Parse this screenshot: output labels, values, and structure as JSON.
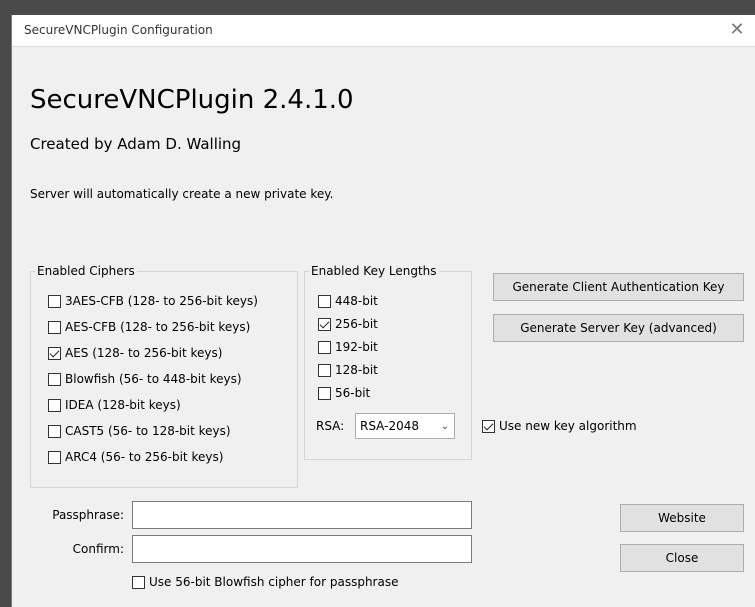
{
  "window": {
    "title": "SecureVNCPlugin Configuration",
    "close_glyph": "✕"
  },
  "header": {
    "title": "SecureVNCPlugin 2.4.1.0",
    "author": "Created by Adam D. Walling",
    "info": "Server will automatically create a new private key."
  },
  "ciphers": {
    "legend": "Enabled Ciphers",
    "items": [
      {
        "label": "3AES-CFB (128- to 256-bit keys)",
        "checked": false
      },
      {
        "label": "AES-CFB (128- to 256-bit keys)",
        "checked": false
      },
      {
        "label": "AES (128- to 256-bit keys)",
        "checked": true
      },
      {
        "label": "Blowfish (56- to 448-bit keys)",
        "checked": false
      },
      {
        "label": "IDEA (128-bit keys)",
        "checked": false
      },
      {
        "label": "CAST5 (56- to 128-bit keys)",
        "checked": false
      },
      {
        "label": "ARC4 (56- to 256-bit keys)",
        "checked": false
      }
    ]
  },
  "key_lengths": {
    "legend": "Enabled Key Lengths",
    "items": [
      {
        "label": "448-bit",
        "checked": false
      },
      {
        "label": "256-bit",
        "checked": true
      },
      {
        "label": "192-bit",
        "checked": false
      },
      {
        "label": "128-bit",
        "checked": false
      },
      {
        "label": "56-bit",
        "checked": false
      }
    ],
    "rsa_label": "RSA:",
    "rsa_value": "RSA-2048"
  },
  "actions": {
    "gen_client_key": "Generate Client Authentication Key",
    "gen_server_key": "Generate Server Key (advanced)",
    "use_new_key_algorithm": "Use new key algorithm",
    "use_new_key_algorithm_checked": true,
    "website": "Website",
    "close": "Close"
  },
  "passphrase": {
    "passphrase_label": "Passphrase:",
    "confirm_label": "Confirm:",
    "passphrase_value": "",
    "confirm_value": "",
    "blowfish_option": "Use 56-bit Blowfish cipher for passphrase",
    "blowfish_checked": false
  }
}
